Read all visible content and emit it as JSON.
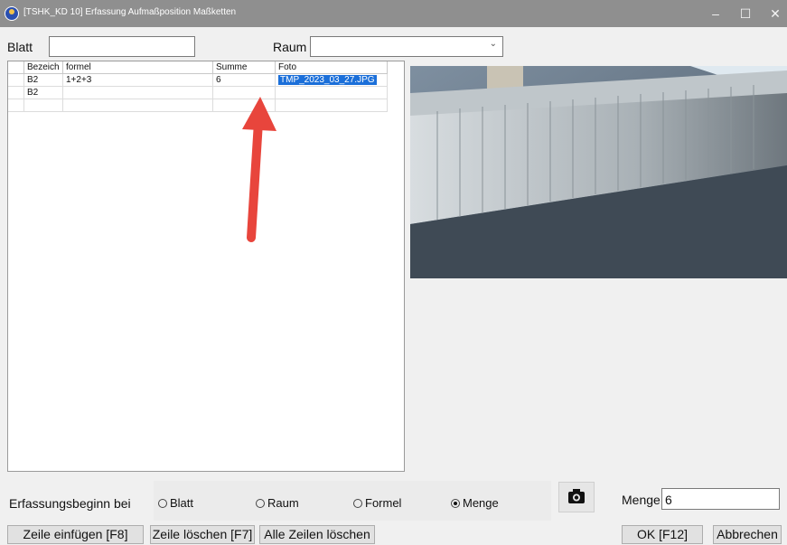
{
  "window": {
    "title": "[TSHK_KD 10] Erfassung Aufmaßposition Maßketten"
  },
  "top": {
    "blatt_label": "Blatt",
    "blatt_value": "",
    "raum_label": "Raum",
    "raum_value": ""
  },
  "grid": {
    "columns": [
      "Bezeich",
      "formel",
      "Summe",
      "Foto"
    ],
    "rows": [
      {
        "bezeich": "B2",
        "formel": "1+2+3",
        "summe": "6",
        "foto": "TMP_2023_03_27.JPG"
      },
      {
        "bezeich": "B2",
        "formel": "",
        "summe": "",
        "foto": ""
      }
    ]
  },
  "bottom": {
    "erfassung_label": "Erfassungsbeginn bei",
    "radios": [
      {
        "label": "Blatt",
        "checked": false
      },
      {
        "label": "Raum",
        "checked": false
      },
      {
        "label": "Formel",
        "checked": false
      },
      {
        "label": "Menge",
        "checked": true
      }
    ],
    "camera_icon": "camera-icon",
    "menge_label": "Menge",
    "menge_value": "6",
    "buttons": {
      "insert": "Zeile einfügen [F8]",
      "delete": "Zeile löschen [F7]",
      "delete_all": "Alle Zeilen löschen",
      "ok": "OK [F12]",
      "cancel": "Abbrechen"
    }
  },
  "colors": {
    "titlebar": "#8f8f8f",
    "selection": "#1b6fd9",
    "arrow": "#e8453c"
  }
}
